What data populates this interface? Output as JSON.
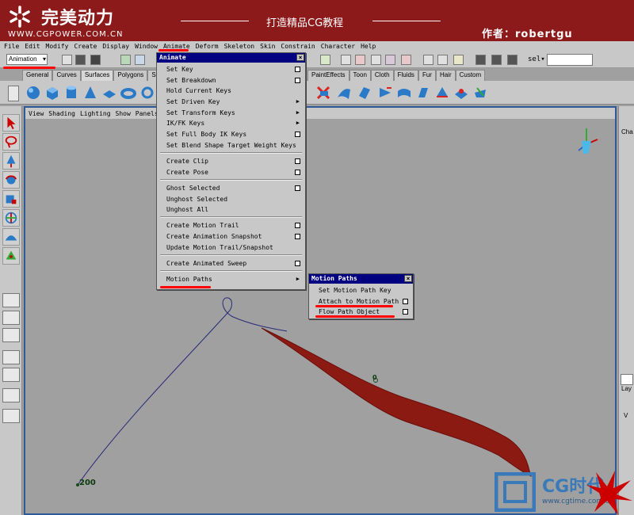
{
  "banner": {
    "logo_text": "完美动力",
    "site_url": "WWW.CGPOWER.COM.CN",
    "slogan": "打造精品CG教程",
    "author": "作者：robertgu"
  },
  "menubar": [
    "File",
    "Edit",
    "Modify",
    "Create",
    "Display",
    "Window",
    "Animate",
    "Deform",
    "Skeleton",
    "Skin",
    "Constrain",
    "Character",
    "Help"
  ],
  "statusline": {
    "mode": "Animation",
    "sel_label": "sel▾"
  },
  "shelf_tabs": [
    "General",
    "Curves",
    "Surfaces",
    "Polygons",
    "Subd"
  ],
  "shelf_tabs_right": [
    "PaintEffects",
    "Toon",
    "Cloth",
    "Fluids",
    "Fur",
    "Hair",
    "Custom"
  ],
  "panel_menu": [
    "View",
    "Shading",
    "Lighting",
    "Show",
    "Panels"
  ],
  "animate_menu": {
    "title": "Animate",
    "items": [
      "Set Key",
      "Set Breakdown",
      "Hold Current Keys",
      "Set Driven Key",
      "Set Transform Keys",
      "IK/FK Keys",
      "Set Full Body IK Keys",
      "Set Blend Shape Target Weight Keys",
      "Create Clip",
      "Create Pose",
      "Ghost Selected",
      "Unghost Selected",
      "Unghost All",
      "Create Motion Trail",
      "Create Animation Snapshot",
      "Update Motion Trail/Snapshot",
      "Create Animated Sweep",
      "Motion Paths"
    ]
  },
  "motion_paths_menu": {
    "title": "Motion Paths",
    "items": [
      "Set Motion Path Key",
      "Attach to Motion Path",
      "Flow Path Object"
    ]
  },
  "viewport": {
    "frame_start_label": "200",
    "frame_mid_label": "0"
  },
  "right_panel": {
    "label_top": "Cha",
    "label_mid": "Lay",
    "label_v": "V"
  },
  "watermark": {
    "brand": "CG时代",
    "url": "www.cgtime.com.cn"
  },
  "colors": {
    "banner": "#8c1a1a",
    "menu_title": "#000080",
    "annotation": "#ff0000",
    "path_curve": "#2a2a7a",
    "object": "#8b1a12",
    "viewport_bg": "#a0a0a0"
  }
}
